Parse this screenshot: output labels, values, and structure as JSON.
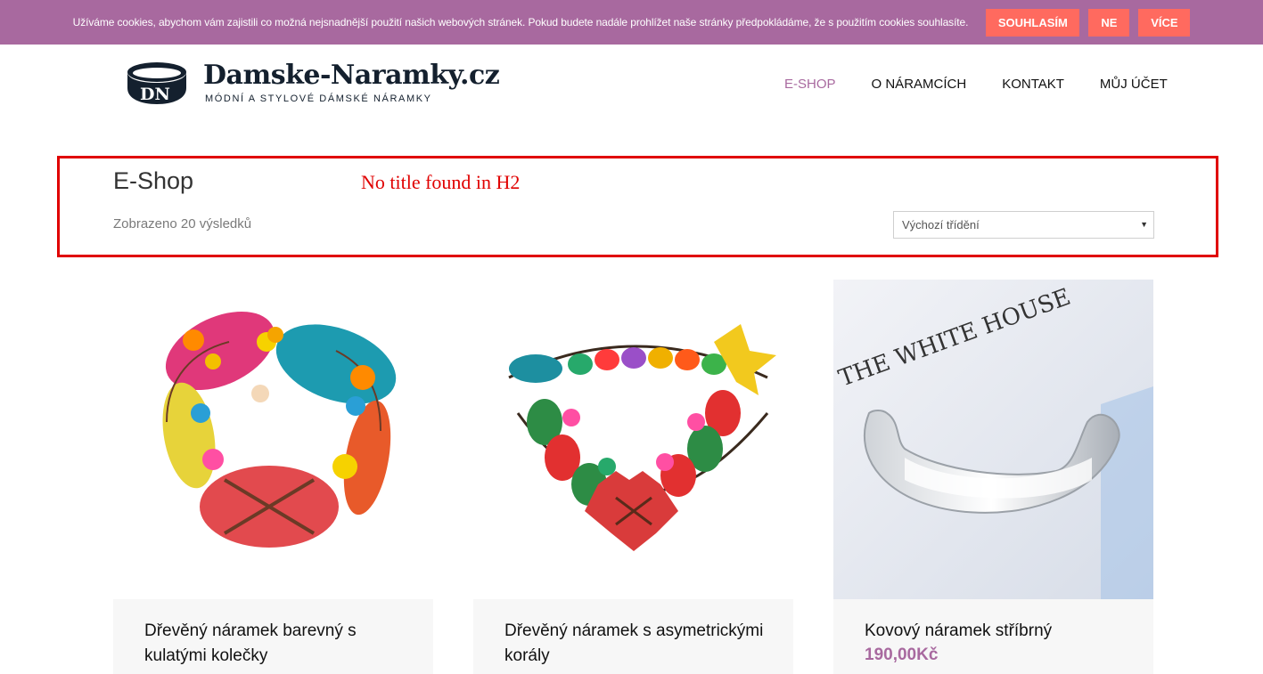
{
  "cookie_bar": {
    "text": "Užíváme cookies, abychom vám zajistili co možná nejsnadnější použití našich webových stránek. Pokud budete nadále prohlížet naše stránky předpokládáme, že s použitím cookies souhlasíte.",
    "agree_label": "SOUHLASÍM",
    "decline_label": "NE",
    "more_label": "VÍCE"
  },
  "logo": {
    "monogram": "DN",
    "name": "Damske-Naramky.cz",
    "tagline": "MÓDNÍ A STYLOVÉ DÁMSKÉ NÁRAMKY"
  },
  "nav": {
    "items": [
      {
        "label": "E-SHOP",
        "active": true
      },
      {
        "label": "O NÁRAMCÍCH",
        "active": false
      },
      {
        "label": "KONTAKT",
        "active": false
      },
      {
        "label": "MŮJ ÚČET",
        "active": false
      }
    ]
  },
  "shop": {
    "title": "E-Shop",
    "debug_note": "No title found in H2",
    "result_count": "Zobrazeno 20 výsledků",
    "sort_selected": "Výchozí třídění"
  },
  "products": [
    {
      "name": "Dřevěný náramek barevný s kulatými kolečky",
      "price": ""
    },
    {
      "name": "Dřevěný náramek s asymetrickými korály",
      "price": ""
    },
    {
      "name": "Kovový náramek stříbrný",
      "price": "190,00Kč"
    }
  ],
  "images": {
    "product3_text": "THE WHITE HOUSE"
  },
  "colors": {
    "brand": "#a8699f",
    "cookie_button": "#ff6a5f",
    "highlight_border": "#e00000"
  }
}
